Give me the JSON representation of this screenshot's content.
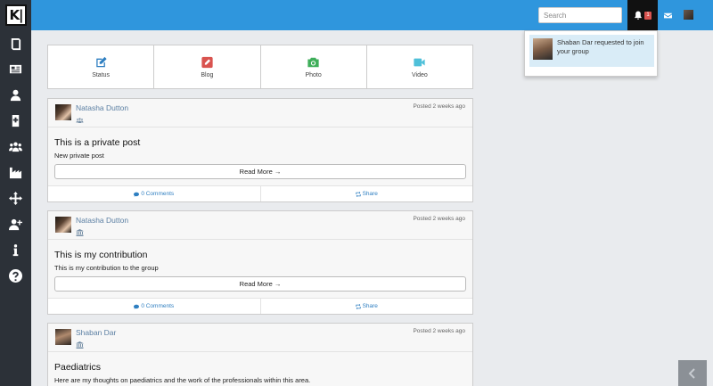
{
  "app": {
    "logo_text": "K|"
  },
  "sidebar": {
    "items": [
      {
        "name": "sidebar-item-book",
        "icon": "book-icon"
      },
      {
        "name": "sidebar-item-news",
        "icon": "newspaper-icon"
      },
      {
        "name": "sidebar-item-profile",
        "icon": "user-icon"
      },
      {
        "name": "sidebar-item-hospital",
        "icon": "hospital-icon"
      },
      {
        "name": "sidebar-item-groups",
        "icon": "group-icon"
      },
      {
        "name": "sidebar-item-industry",
        "icon": "factory-icon"
      },
      {
        "name": "sidebar-item-network",
        "icon": "network-icon"
      },
      {
        "name": "sidebar-item-add-user",
        "icon": "user-plus-icon"
      },
      {
        "name": "sidebar-item-info",
        "icon": "info-icon"
      },
      {
        "name": "sidebar-item-help",
        "icon": "help-icon"
      }
    ]
  },
  "header": {
    "search_placeholder": "Search",
    "notification_count": "1"
  },
  "notifications": {
    "items": [
      {
        "text": "Shaban Dar requested to join your group"
      }
    ]
  },
  "composer": {
    "buttons": [
      {
        "label": "Status",
        "icon": "edit-icon",
        "color": "#2f7fc1"
      },
      {
        "label": "Blog",
        "icon": "pencil-icon",
        "color": "#d9534f"
      },
      {
        "label": "Photo",
        "icon": "camera-icon",
        "color": "#3fae5a"
      },
      {
        "label": "Video",
        "icon": "video-camera-icon",
        "color": "#4fc0d9"
      }
    ]
  },
  "posts": [
    {
      "author": "Natasha Dutton",
      "type_icon": "group-icon",
      "time": "Posted 2 weeks ago",
      "title": "This is a private post",
      "body": "New private post",
      "read_more": "Read More →",
      "comments": "0 Comments",
      "share": "Share"
    },
    {
      "author": "Natasha Dutton",
      "type_icon": "bank-icon",
      "time": "Posted 2 weeks ago",
      "title": "This is my contribution",
      "body": "This is my contribution to the group",
      "read_more": "Read More →",
      "comments": "0 Comments",
      "share": "Share"
    },
    {
      "author": "Shaban Dar",
      "type_icon": "bank-icon",
      "time": "Posted 2 weeks ago",
      "title": "Paediatrics",
      "body": "Here are my thoughts on paediatrics and the work of the professionals within this area."
    }
  ],
  "colors": {
    "topbar": "#2f96dd",
    "sidebar": "#2c3138",
    "link": "#2f7fc1",
    "badge": "#d9534f"
  }
}
